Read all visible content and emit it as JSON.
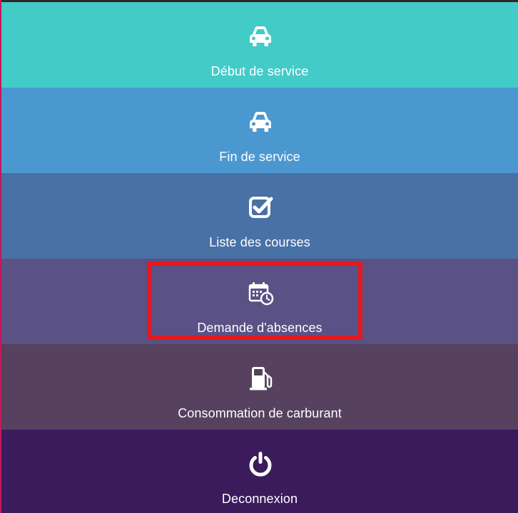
{
  "menu": {
    "items": [
      {
        "label": "Début de service",
        "icon": "car-icon",
        "color": "#43cbc8"
      },
      {
        "label": "Fin de service",
        "icon": "car-icon",
        "color": "#4b98d0"
      },
      {
        "label": "Liste des courses",
        "icon": "checkbox-checked-icon",
        "color": "#4871a6"
      },
      {
        "label": "Demande d'absences",
        "icon": "calendar-clock-icon",
        "color": "#5a5185"
      },
      {
        "label": "Consommation de carburant",
        "icon": "fuel-pump-icon",
        "color": "#56415f"
      },
      {
        "label": "Deconnexion",
        "icon": "power-icon",
        "color": "#3b1b5c"
      }
    ]
  },
  "highlight": {
    "target": "Demande d'absences",
    "color": "#e3191f"
  }
}
